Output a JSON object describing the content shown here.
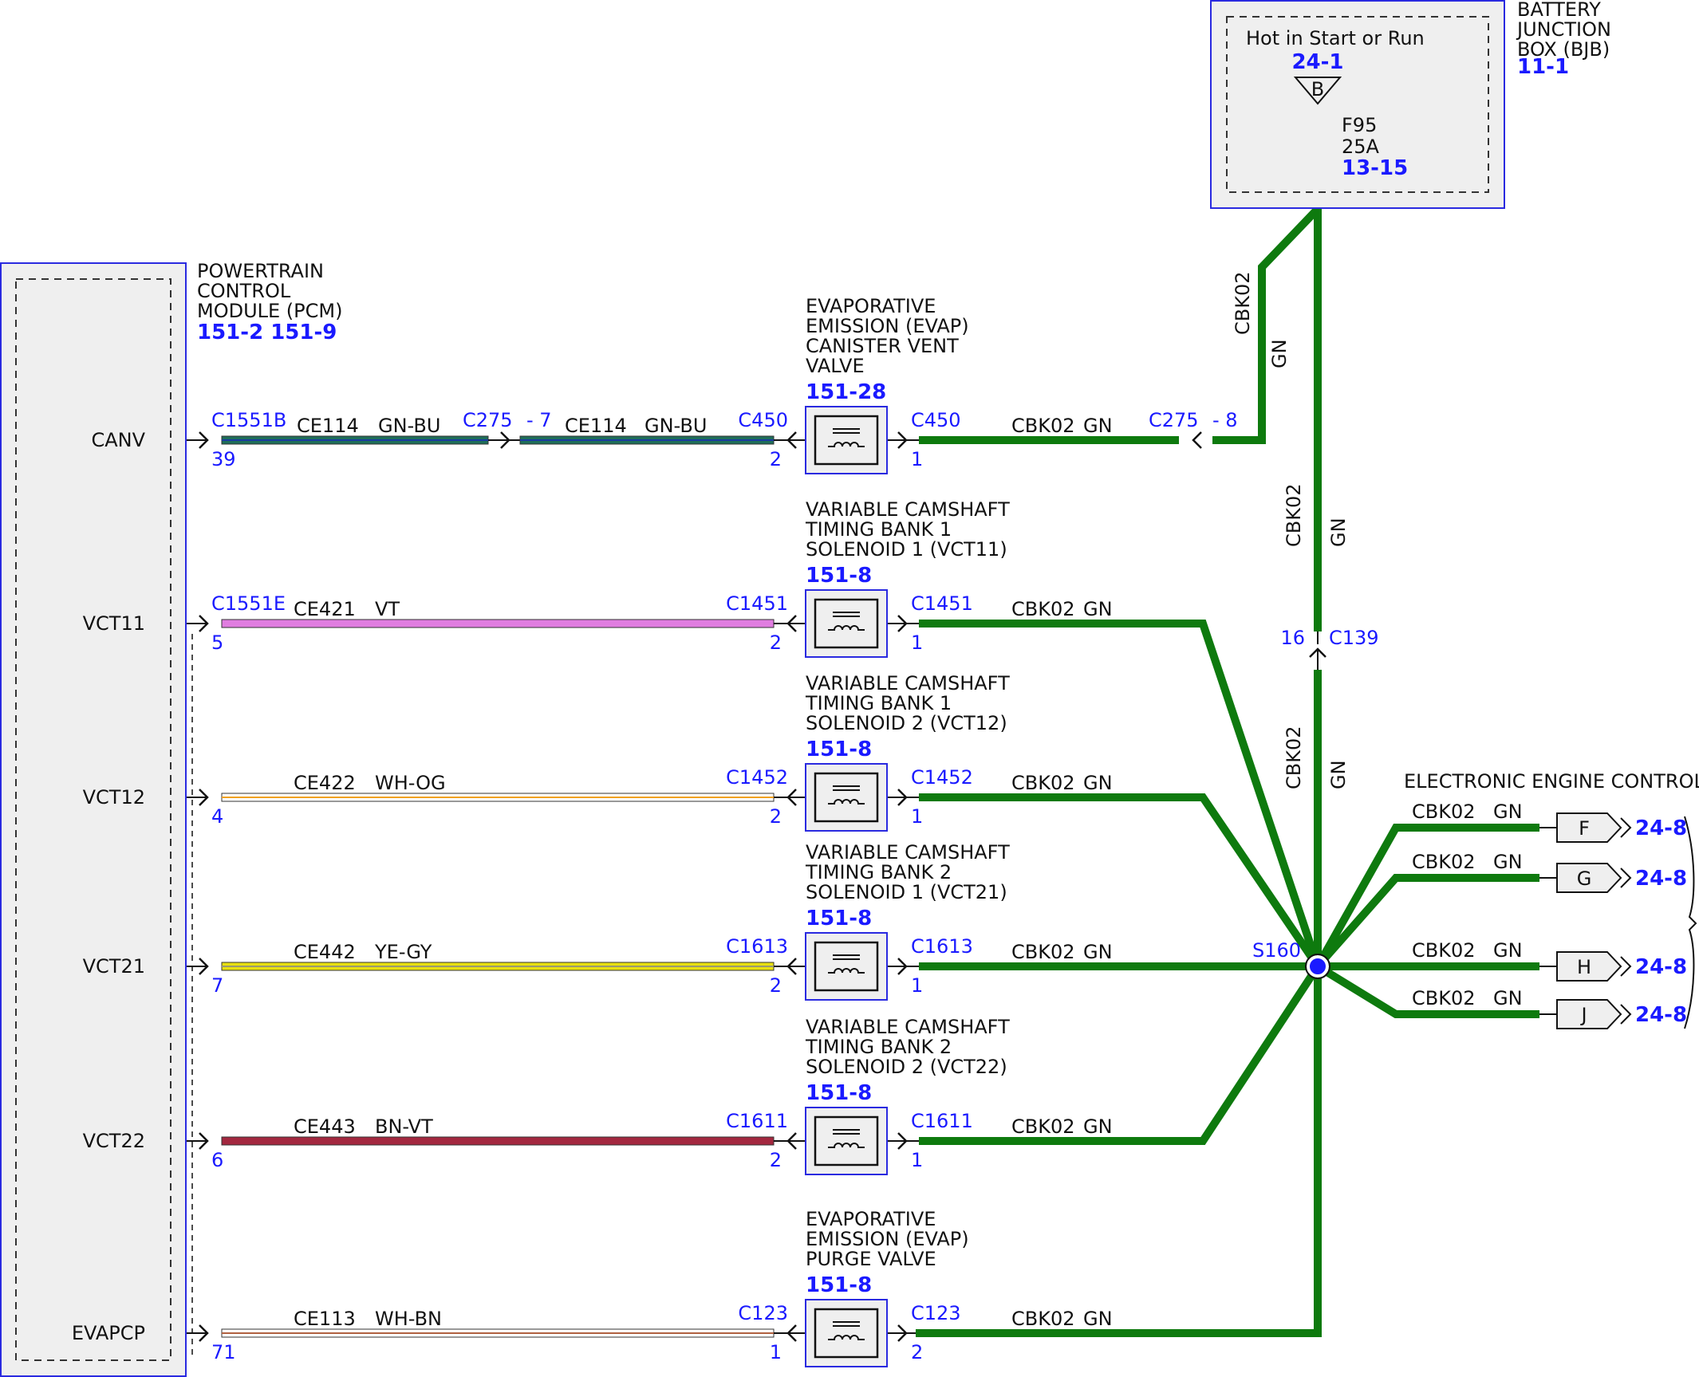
{
  "bjb": {
    "name_lines": [
      "BATTERY",
      "JUNCTION",
      "BOX (BJB)"
    ],
    "ref": "11-1",
    "hot_label": "Hot in Start or Run",
    "hot_ref": "24-1",
    "bus": "B",
    "fuse": {
      "name": "F95",
      "rating": "25A",
      "ref": "13-15"
    }
  },
  "pcm": {
    "name_lines": [
      "POWERTRAIN",
      "CONTROL",
      "MODULE (PCM)"
    ],
    "refs": "151-2 151-9"
  },
  "wire_colors": {
    "GN": "#0e7a0e",
    "GN-BU": "#1f6e5a",
    "VT": "#e07de0",
    "WH-OG": "#ffffff",
    "YE-GY": "#e8e010",
    "BN-VT": "#a3283f",
    "WH-BN": "#ffffff",
    "accent": "#1a1aff"
  },
  "circuits": [
    {
      "pin_name": "CANV",
      "pin": "39",
      "conn": "C1551B",
      "circuit": "CE114",
      "color": "GN-BU",
      "inline": {
        "conn": "C275",
        "pin": "7"
      },
      "comp_conn": "C450",
      "comp_pin_in": "2",
      "comp_pin_out": "1",
      "component_lines": [
        "EVAPORATIVE",
        "EMISSION (EVAP)",
        "CANISTER VENT",
        "VALVE"
      ],
      "component_ref": "151-28",
      "feed_circuit": "CBK02",
      "feed_color": "GN",
      "feed_inline": {
        "conn": "C275",
        "pin": "8"
      }
    },
    {
      "pin_name": "VCT11",
      "pin": "5",
      "conn": "C1551E",
      "circuit": "CE421",
      "color": "VT",
      "comp_conn": "C1451",
      "comp_pin_in": "2",
      "comp_pin_out": "1",
      "component_lines": [
        "VARIABLE CAMSHAFT",
        "TIMING BANK 1",
        "SOLENOID 1 (VCT11)"
      ],
      "component_ref": "151-8",
      "feed_circuit": "CBK02",
      "feed_color": "GN"
    },
    {
      "pin_name": "VCT12",
      "pin": "4",
      "circuit": "CE422",
      "color": "WH-OG",
      "comp_conn": "C1452",
      "comp_pin_in": "2",
      "comp_pin_out": "1",
      "component_lines": [
        "VARIABLE CAMSHAFT",
        "TIMING BANK 1",
        "SOLENOID 2 (VCT12)"
      ],
      "component_ref": "151-8",
      "feed_circuit": "CBK02",
      "feed_color": "GN"
    },
    {
      "pin_name": "VCT21",
      "pin": "7",
      "circuit": "CE442",
      "color": "YE-GY",
      "comp_conn": "C1613",
      "comp_pin_in": "2",
      "comp_pin_out": "1",
      "component_lines": [
        "VARIABLE CAMSHAFT",
        "TIMING BANK 2",
        "SOLENOID 1 (VCT21)"
      ],
      "component_ref": "151-8",
      "feed_circuit": "CBK02",
      "feed_color": "GN"
    },
    {
      "pin_name": "VCT22",
      "pin": "6",
      "circuit": "CE443",
      "color": "BN-VT",
      "comp_conn": "C1611",
      "comp_pin_in": "2",
      "comp_pin_out": "1",
      "component_lines": [
        "VARIABLE CAMSHAFT",
        "TIMING BANK 2",
        "SOLENOID 2 (VCT22)"
      ],
      "component_ref": "151-8",
      "feed_circuit": "CBK02",
      "feed_color": "GN"
    },
    {
      "pin_name": "EVAPCP",
      "pin": "71",
      "circuit": "CE113",
      "color": "WH-BN",
      "comp_conn": "C123",
      "comp_pin_in": "1",
      "comp_pin_out": "2",
      "component_lines": [
        "EVAPORATIVE",
        "EMISSION (EVAP)",
        "PURGE VALVE"
      ],
      "component_ref": "151-8",
      "feed_circuit": "CBK02",
      "feed_color": "GN"
    }
  ],
  "trunk": {
    "circuit": "CBK02",
    "color": "GN",
    "inline_conn": "C139",
    "inline_pin": "16",
    "splice": "S160"
  },
  "eec": {
    "title": "ELECTRONIC ENGINE CONTROLS",
    "outputs": [
      {
        "letter": "F",
        "circuit": "CBK02",
        "color": "GN",
        "ref": "24-8"
      },
      {
        "letter": "G",
        "circuit": "CBK02",
        "color": "GN",
        "ref": "24-8"
      },
      {
        "letter": "H",
        "circuit": "CBK02",
        "color": "GN",
        "ref": "24-8"
      },
      {
        "letter": "J",
        "circuit": "CBK02",
        "color": "GN",
        "ref": "24-8"
      }
    ]
  }
}
